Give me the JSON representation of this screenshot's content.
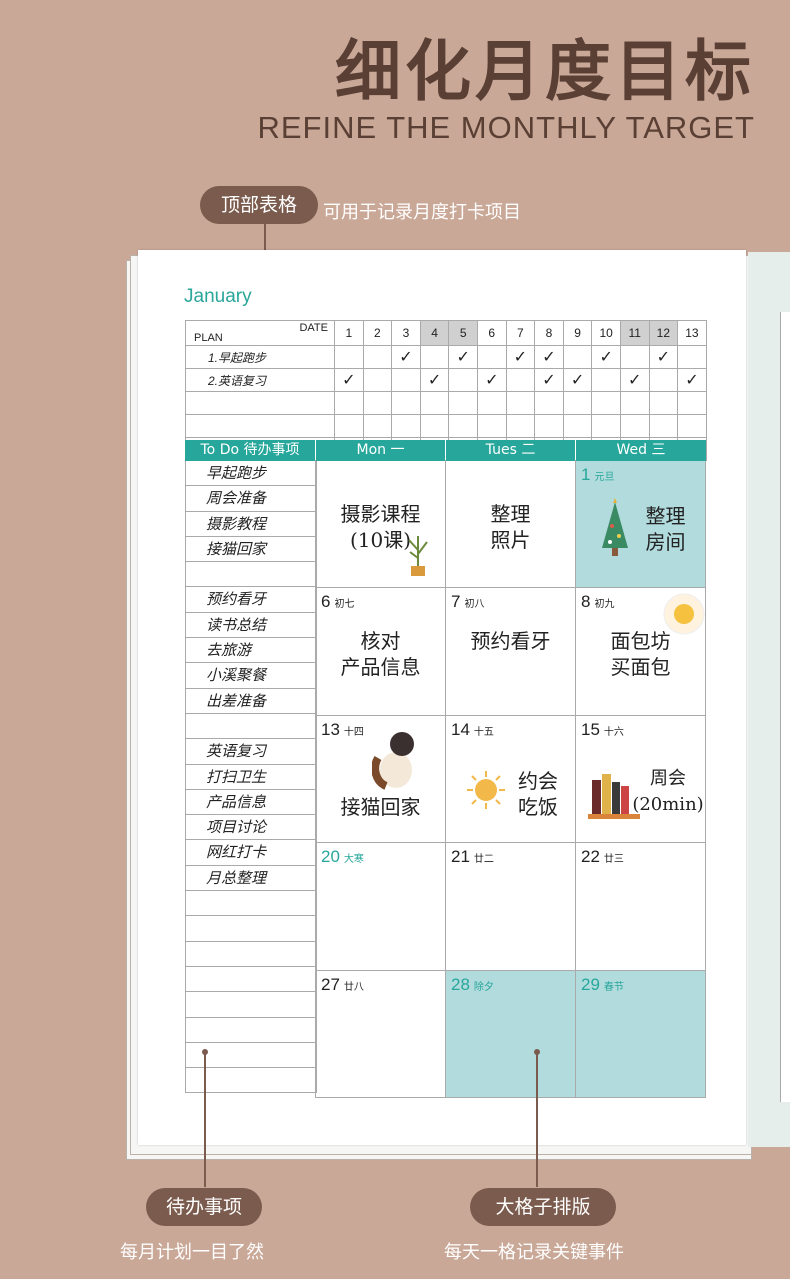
{
  "header": {
    "title": "细化月度目标",
    "subtitle": "REFINE THE MONTHLY TARGET"
  },
  "callouts": {
    "top_table": {
      "label": "顶部表格",
      "desc": "可用于记录月度打卡项目"
    },
    "todo": {
      "label": "待办事项",
      "desc": "每月计划一目了然"
    },
    "grid": {
      "label": "大格子排版",
      "desc": "每天一格记录关键事件"
    }
  },
  "planner": {
    "month": "January",
    "plan_label": "PLAN",
    "date_label": "DATE",
    "dates": [
      "1",
      "2",
      "3",
      "4",
      "5",
      "6",
      "7",
      "8",
      "9",
      "10",
      "11",
      "12",
      "13"
    ],
    "weekend_dates": [
      "4",
      "5",
      "11",
      "12"
    ],
    "habits": [
      {
        "name": "1.早起跑步",
        "checks": [
          3,
          5,
          7,
          8,
          10,
          12
        ]
      },
      {
        "name": "2.英语复习",
        "checks": [
          1,
          4,
          6,
          8,
          9,
          11,
          13
        ]
      }
    ],
    "todo_header": "To Do  待办事项",
    "day_headers": [
      "Mon 一",
      "Tues 二",
      "Wed 三"
    ],
    "todo_items": [
      "早起跑步",
      "周会准备",
      "摄影教程",
      "接猫回家",
      "",
      "预约看牙",
      "读书总结",
      "去旅游",
      "小溪聚餐",
      "出差准备",
      "",
      "英语复习",
      "打扫卫生",
      "产品信息",
      "项目讨论",
      "网红打卡",
      "月总整理",
      "",
      "",
      "",
      "",
      "",
      "",
      "",
      ""
    ],
    "weeks": [
      [
        {
          "day": "",
          "lunar": "",
          "note": "摄影课程\n(10课)"
        },
        {
          "day": "",
          "lunar": "",
          "note": "整理\n照片"
        },
        {
          "day": "1",
          "lunar": "元旦",
          "note": "整理\n房间",
          "teal": true
        }
      ],
      [
        {
          "day": "6",
          "lunar": "初七",
          "note": "核对\n产品信息"
        },
        {
          "day": "7",
          "lunar": "初八",
          "note": "预约看牙"
        },
        {
          "day": "8",
          "lunar": "初九",
          "note": "面包坊\n买面包"
        }
      ],
      [
        {
          "day": "13",
          "lunar": "十四",
          "note": "接猫回家"
        },
        {
          "day": "14",
          "lunar": "十五",
          "note": "约会\n吃饭"
        },
        {
          "day": "15",
          "lunar": "十六",
          "note": "周会\n(20min)"
        }
      ],
      [
        {
          "day": "20",
          "lunar": "大寒",
          "note": "",
          "tday": true
        },
        {
          "day": "21",
          "lunar": "廿二",
          "note": ""
        },
        {
          "day": "22",
          "lunar": "廿三",
          "note": ""
        }
      ],
      [
        {
          "day": "27",
          "lunar": "廿八",
          "note": ""
        },
        {
          "day": "28",
          "lunar": "除夕",
          "note": "",
          "teal": true,
          "tday": true
        },
        {
          "day": "29",
          "lunar": "春节",
          "note": "",
          "teal": true,
          "tday": true
        }
      ]
    ]
  },
  "colors": {
    "background": "#caa898",
    "accent": "#27a79b",
    "callout": "#7b5b4d",
    "teal_cell": "#b1dbdd"
  }
}
